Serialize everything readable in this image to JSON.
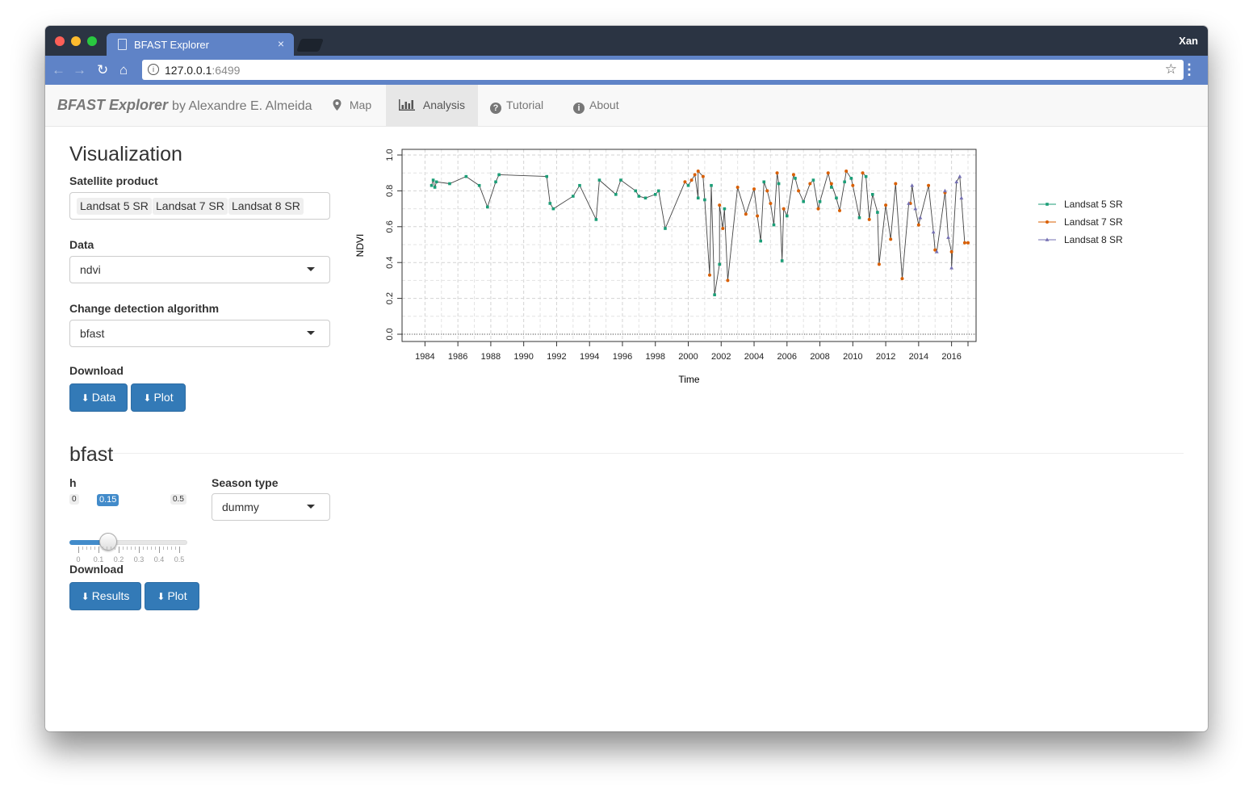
{
  "browser": {
    "tab_title": "BFAST Explorer",
    "tab_close": "×",
    "user_name": "Xan",
    "url_host": "127.0.0.1",
    "url_port": ":6499"
  },
  "navbar": {
    "brand_name": "BFAST Explorer",
    "brand_by": "by Alexandre E. Almeida",
    "items": [
      {
        "label": "Map",
        "icon": "map-marker-icon"
      },
      {
        "label": "Analysis",
        "icon": "bar-chart-icon",
        "active": true
      },
      {
        "label": "Tutorial",
        "icon": "question-circle-icon"
      },
      {
        "label": "About",
        "icon": "info-circle-icon"
      }
    ]
  },
  "visualization": {
    "heading": "Visualization",
    "satellite_label": "Satellite product",
    "satellite_selected": [
      "Landsat 5 SR",
      "Landsat 7 SR",
      "Landsat 8 SR"
    ],
    "data_label": "Data",
    "data_value": "ndvi",
    "algorithm_label": "Change detection algorithm",
    "algorithm_value": "bfast",
    "download_label": "Download",
    "download_data": "Data",
    "download_plot": "Plot"
  },
  "bfast": {
    "heading": "bfast",
    "h_label": "h",
    "h_min": "0",
    "h_max": "0.5",
    "h_value": "0.15",
    "h_ticks": [
      "0",
      "0.1",
      "0.2",
      "0.3",
      "0.4",
      "0.5"
    ],
    "season_label": "Season type",
    "season_value": "dummy",
    "download_label": "Download",
    "download_results": "Results",
    "download_plot": "Plot"
  },
  "colors": {
    "landsat5": "#1b9e77",
    "landsat7": "#d95f02",
    "landsat8": "#7570b3",
    "button": "#337ab7"
  },
  "chart_data": {
    "type": "line",
    "xlabel": "Time",
    "ylabel": "NDVI",
    "xlim": [
      1983,
      2017
    ],
    "ylim": [
      0.0,
      1.0
    ],
    "x_ticks": [
      "1984",
      "1986",
      "1988",
      "1990",
      "1992",
      "1994",
      "1996",
      "1998",
      "2000",
      "2002",
      "2004",
      "2006",
      "2008",
      "2010",
      "2012",
      "2014",
      "2016"
    ],
    "y_ticks": [
      "0.0",
      "0.2",
      "0.4",
      "0.6",
      "0.8",
      "1.0"
    ],
    "grid": true,
    "legend_position": "right",
    "series": [
      {
        "name": "Landsat 5 SR",
        "marker": "square",
        "color": "#1b9e77",
        "points": [
          [
            1984.4,
            0.83
          ],
          [
            1984.5,
            0.86
          ],
          [
            1984.6,
            0.82
          ],
          [
            1984.7,
            0.85
          ],
          [
            1985.5,
            0.84
          ],
          [
            1986.5,
            0.88
          ],
          [
            1987.3,
            0.83
          ],
          [
            1987.8,
            0.71
          ],
          [
            1988.3,
            0.85
          ],
          [
            1988.5,
            0.89
          ],
          [
            1991.4,
            0.88
          ],
          [
            1991.6,
            0.73
          ],
          [
            1991.8,
            0.7
          ],
          [
            1993.0,
            0.77
          ],
          [
            1993.4,
            0.83
          ],
          [
            1994.4,
            0.64
          ],
          [
            1994.6,
            0.86
          ],
          [
            1995.6,
            0.78
          ],
          [
            1995.9,
            0.86
          ],
          [
            1996.8,
            0.8
          ],
          [
            1997.0,
            0.77
          ],
          [
            1997.4,
            0.76
          ],
          [
            1998.0,
            0.78
          ],
          [
            1998.2,
            0.8
          ],
          [
            1998.6,
            0.59
          ],
          [
            2000.0,
            0.83
          ],
          [
            2000.6,
            0.76
          ],
          [
            2001.0,
            0.75
          ],
          [
            2001.4,
            0.83
          ],
          [
            2001.6,
            0.22
          ],
          [
            2001.9,
            0.39
          ],
          [
            2002.2,
            0.7
          ],
          [
            2004.4,
            0.52
          ],
          [
            2004.6,
            0.85
          ],
          [
            2005.2,
            0.61
          ],
          [
            2005.5,
            0.84
          ],
          [
            2005.7,
            0.41
          ],
          [
            2006.0,
            0.66
          ],
          [
            2006.5,
            0.87
          ],
          [
            2007.0,
            0.74
          ],
          [
            2007.6,
            0.86
          ],
          [
            2008.0,
            0.74
          ],
          [
            2008.7,
            0.82
          ],
          [
            2009.0,
            0.76
          ],
          [
            2009.5,
            0.85
          ],
          [
            2009.9,
            0.87
          ],
          [
            2010.4,
            0.65
          ],
          [
            2010.8,
            0.88
          ],
          [
            2011.2,
            0.78
          ],
          [
            2011.5,
            0.68
          ]
        ]
      },
      {
        "name": "Landsat 7 SR",
        "marker": "circle",
        "color": "#d95f02",
        "points": [
          [
            1999.8,
            0.85
          ],
          [
            2000.2,
            0.86
          ],
          [
            2000.4,
            0.89
          ],
          [
            2000.6,
            0.91
          ],
          [
            2000.9,
            0.88
          ],
          [
            2001.3,
            0.33
          ],
          [
            2001.9,
            0.72
          ],
          [
            2002.1,
            0.59
          ],
          [
            2002.4,
            0.3
          ],
          [
            2003.0,
            0.82
          ],
          [
            2003.5,
            0.67
          ],
          [
            2004.0,
            0.81
          ],
          [
            2004.2,
            0.66
          ],
          [
            2004.8,
            0.8
          ],
          [
            2005.0,
            0.73
          ],
          [
            2005.4,
            0.9
          ],
          [
            2005.8,
            0.7
          ],
          [
            2006.4,
            0.89
          ],
          [
            2006.7,
            0.8
          ],
          [
            2007.4,
            0.84
          ],
          [
            2007.9,
            0.7
          ],
          [
            2008.5,
            0.9
          ],
          [
            2008.7,
            0.84
          ],
          [
            2009.2,
            0.69
          ],
          [
            2009.6,
            0.91
          ],
          [
            2010.0,
            0.83
          ],
          [
            2010.6,
            0.9
          ],
          [
            2011.0,
            0.64
          ],
          [
            2011.6,
            0.39
          ],
          [
            2012.0,
            0.72
          ],
          [
            2012.3,
            0.53
          ],
          [
            2012.6,
            0.84
          ],
          [
            2013.0,
            0.31
          ],
          [
            2013.5,
            0.73
          ],
          [
            2014.0,
            0.61
          ],
          [
            2014.6,
            0.83
          ],
          [
            2015.0,
            0.47
          ],
          [
            2015.6,
            0.79
          ],
          [
            2016.0,
            0.46
          ],
          [
            2016.8,
            0.51
          ],
          [
            2017.0,
            0.51
          ]
        ]
      },
      {
        "name": "Landsat 8 SR",
        "marker": "triangle",
        "color": "#7570b3",
        "points": [
          [
            2013.4,
            0.73
          ],
          [
            2013.6,
            0.83
          ],
          [
            2013.8,
            0.7
          ],
          [
            2014.1,
            0.65
          ],
          [
            2014.9,
            0.57
          ],
          [
            2015.1,
            0.46
          ],
          [
            2015.6,
            0.8
          ],
          [
            2015.8,
            0.54
          ],
          [
            2016.0,
            0.37
          ],
          [
            2016.3,
            0.85
          ],
          [
            2016.5,
            0.88
          ],
          [
            2016.6,
            0.76
          ]
        ]
      }
    ]
  }
}
